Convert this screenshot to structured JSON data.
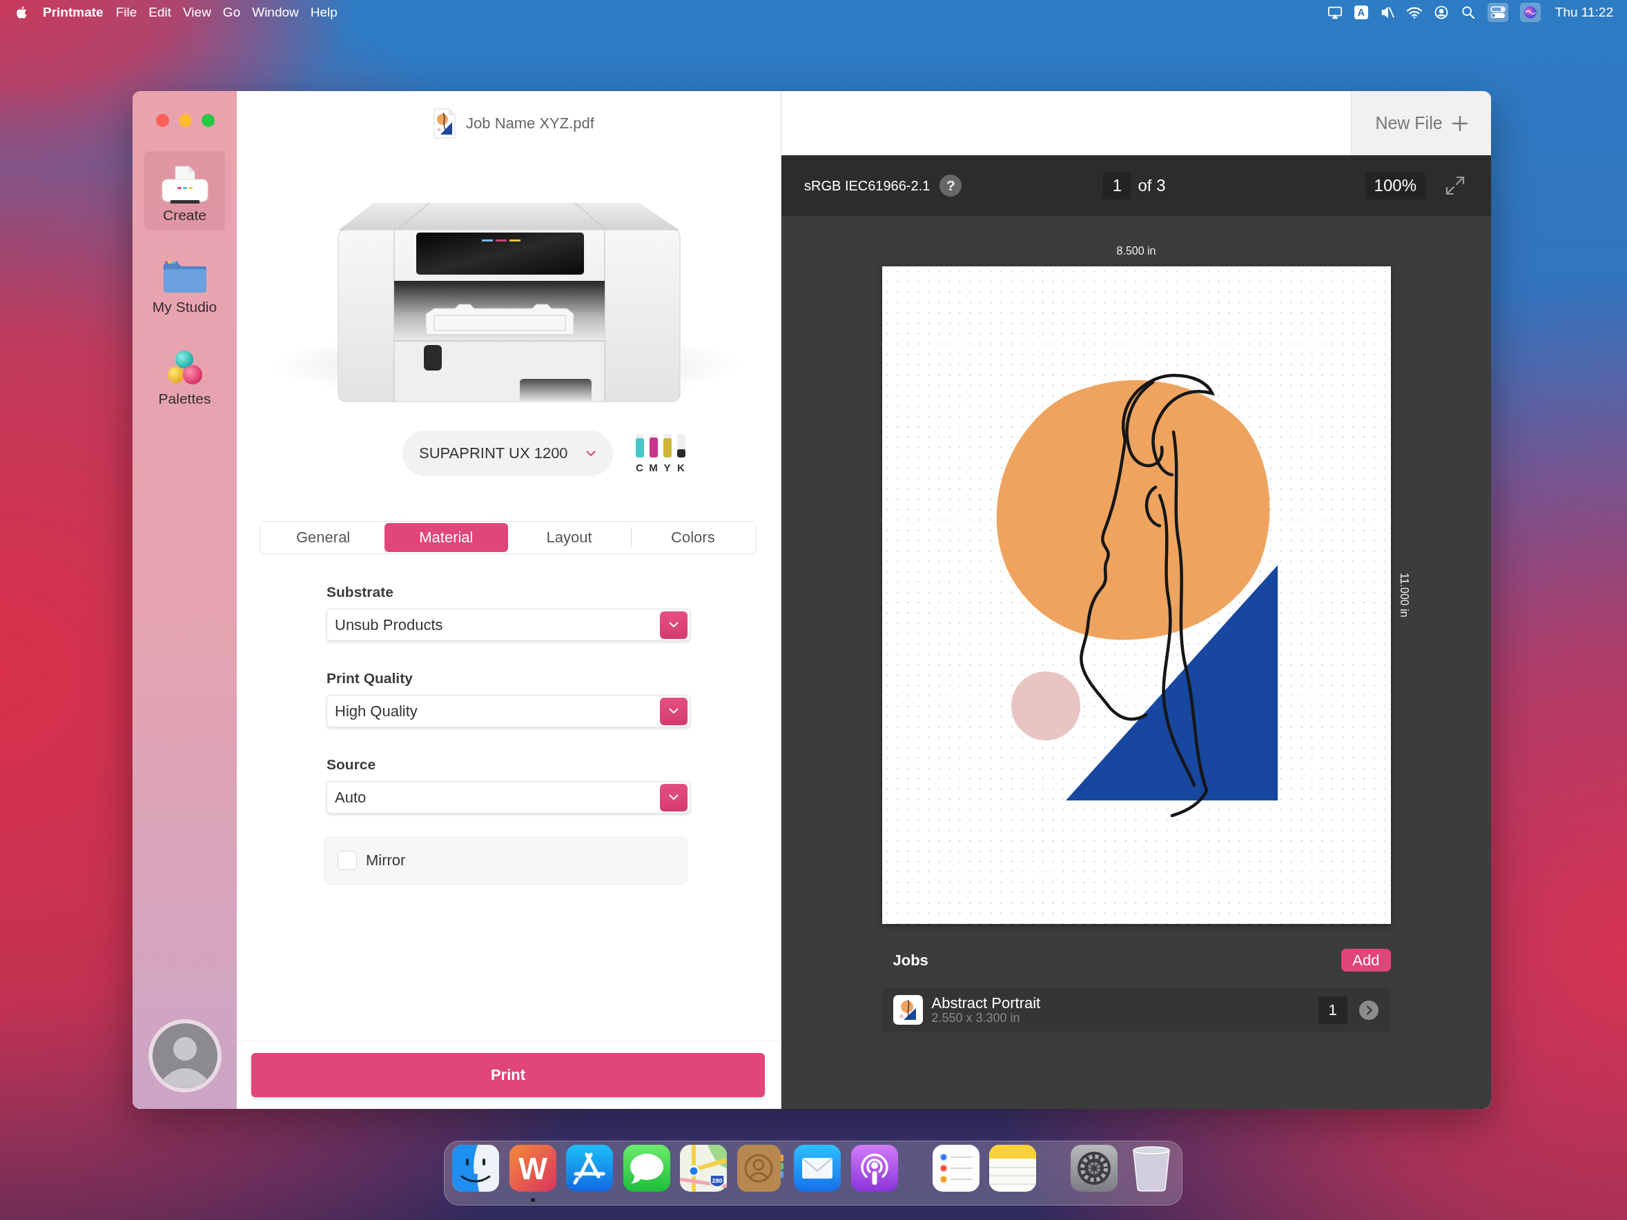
{
  "menu_bar": {
    "app_name": "Printmate",
    "menus": [
      "File",
      "Edit",
      "View",
      "Go",
      "Window",
      "Help"
    ],
    "input_source": "A",
    "clock": "Thu 11:22"
  },
  "sidebar": {
    "items": [
      {
        "label": "Create",
        "selected": true
      },
      {
        "label": "My Studio",
        "selected": false
      },
      {
        "label": "Palettes",
        "selected": false
      }
    ]
  },
  "document": {
    "title": "Job Name XYZ.pdf"
  },
  "printer": {
    "model": "SUPAPRINT UX 1200",
    "inks": [
      {
        "label": "C",
        "color": "#45c9c8",
        "level": 0.8
      },
      {
        "label": "M",
        "color": "#c8358a",
        "level": 0.85
      },
      {
        "label": "Y",
        "color": "#cfb63a",
        "level": 0.8
      },
      {
        "label": "K",
        "color": "#2b2b2b",
        "level": 0.35
      }
    ]
  },
  "tabs": [
    {
      "label": "General",
      "selected": false
    },
    {
      "label": "Material",
      "selected": true
    },
    {
      "label": "Layout",
      "selected": false
    },
    {
      "label": "Colors",
      "selected": false
    }
  ],
  "fields": [
    {
      "label": "Substrate",
      "value": "Unsub Products"
    },
    {
      "label": "Print Quality",
      "value": "High Quality"
    },
    {
      "label": "Source",
      "value": "Auto"
    }
  ],
  "mirror": {
    "label": "Mirror",
    "checked": false
  },
  "print_button": "Print",
  "new_file_button": "New File",
  "preview_toolbar": {
    "color_profile": "sRGB IEC61966-2.1",
    "help": "?",
    "page": "1",
    "page_count": "of 3",
    "zoom": "100%"
  },
  "page": {
    "width_label": "8.500 in",
    "height_label": "11.000 in"
  },
  "jobs": {
    "title": "Jobs",
    "add_button": "Add",
    "items": [
      {
        "name": "Abstract Portrait",
        "size": "2.550 x 3.300 in",
        "copies": "1"
      }
    ]
  },
  "dock": {
    "groups": [
      {
        "apps": [
          {
            "running": false
          },
          {
            "running": true,
            "logo_text": "W"
          },
          {
            "running": false
          },
          {
            "running": false
          },
          {
            "running": false,
            "logo_text": "280"
          },
          {
            "running": false
          },
          {
            "running": false
          },
          {
            "running": false
          }
        ]
      },
      {
        "apps": [
          {
            "running": false
          },
          {
            "running": false
          }
        ]
      },
      {
        "apps": [
          {
            "running": false
          },
          {
            "running": false
          }
        ]
      }
    ]
  }
}
